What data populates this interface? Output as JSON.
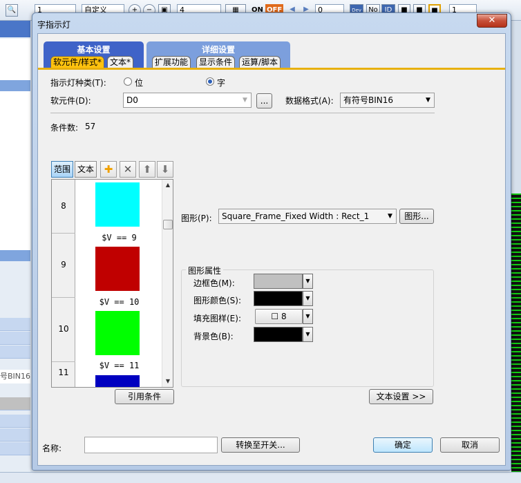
{
  "bg": {
    "tb_combo1": "1",
    "tb_combo2": "自定义",
    "tb_combo3": "4",
    "tb_on": "ON",
    "tb_off": "OFF",
    "tb_combo4": "0",
    "tb_combo5": "1",
    "left_text": "号BIN16"
  },
  "dialog": {
    "title": "字指示灯",
    "close_label": "✕"
  },
  "tabs": {
    "basic_title": "基本设置",
    "detail_title": "详细设置",
    "basic_sub": [
      "软元件/样式*",
      "文本*"
    ],
    "detail_sub": [
      "扩展功能",
      "显示条件",
      "运算/脚本"
    ]
  },
  "form": {
    "lamp_type_label": "指示灯种类(T):",
    "radio_bit": "位",
    "radio_word": "字",
    "device_label": "软元件(D):",
    "device_value": "D0",
    "browse_label": "...",
    "data_format_label": "数据格式(A):",
    "data_format_value": "有符号BIN16",
    "condition_count_label": "条件数:",
    "condition_count": "57"
  },
  "cond_toolbar": {
    "range": "范围",
    "text": "文本"
  },
  "conditions": [
    {
      "num": "8",
      "color": "#00ffff",
      "expr": "$V  ==  9"
    },
    {
      "num": "9",
      "color": "#c00000",
      "expr": "$V  ==  10"
    },
    {
      "num": "10",
      "color": "#00ff00",
      "expr": "$V  ==  11"
    },
    {
      "num": "11",
      "color": "#0000c0",
      "expr": ""
    }
  ],
  "shape": {
    "label": "图形(P):",
    "value": "Square_Frame_Fixed Width : Rect_1",
    "button": "图形..."
  },
  "attrs": {
    "group_title": "图形属性",
    "border_color_label": "边框色(M):",
    "border_color": "#c0c0c0",
    "shape_color_label": "图形颜色(S):",
    "shape_color": "#000000",
    "fill_pattern_label": "填充图样(E):",
    "fill_pattern_value": "8",
    "bg_color_label": "背景色(B):",
    "bg_color": "#000000"
  },
  "buttons": {
    "ref_condition": "引用条件",
    "text_settings": "文本设置 >>",
    "name_label": "名称:",
    "name_value": "",
    "convert": "转换至开关...",
    "ok": "确定",
    "cancel": "取消"
  }
}
